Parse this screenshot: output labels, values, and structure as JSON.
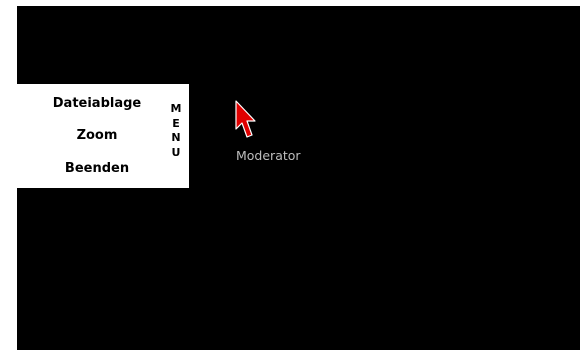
{
  "menu": {
    "items": [
      {
        "label": "Dateiablage"
      },
      {
        "label": "Zoom"
      },
      {
        "label": "Beenden"
      }
    ],
    "toggle_letters": [
      "M",
      "E",
      "N",
      "U"
    ]
  },
  "cursor": {
    "label": "Moderator",
    "color": "#e00000",
    "icon": "arrow-pointer-icon"
  },
  "colors": {
    "background": "#000000",
    "menu_background": "#ffffff",
    "cursor_label": "#bdbdbd"
  }
}
